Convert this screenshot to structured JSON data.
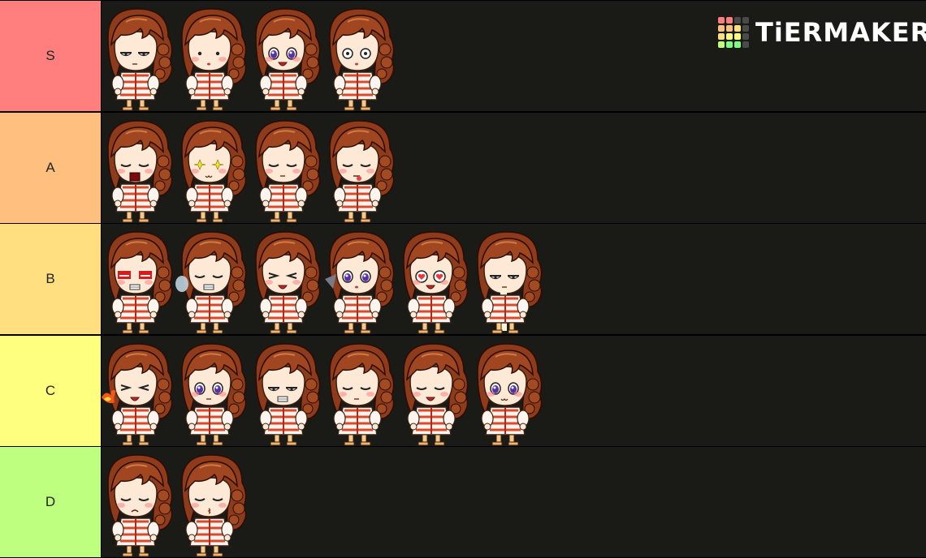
{
  "brand": {
    "name": "TiERMAKER",
    "logo_colors": [
      "#ff7f7f",
      "#ffbf7f",
      "#ffdf7f",
      "#ffff7f",
      "#bfff7f",
      "#7fff7f",
      "#4a4a4a"
    ]
  },
  "tiers": [
    {
      "label": "S",
      "color": "#ff7f7f",
      "items": [
        {
          "name": "annoyed",
          "eyes": "half",
          "mouth": "flat",
          "extra": ""
        },
        {
          "name": "blush",
          "eyes": "dot",
          "mouth": "small",
          "extra": "blush"
        },
        {
          "name": "sparkle-purple",
          "eyes": "purple",
          "mouth": "open",
          "extra": "blush"
        },
        {
          "name": "surprised",
          "eyes": "wide",
          "mouth": "small",
          "extra": ""
        }
      ]
    },
    {
      "label": "A",
      "color": "#ffbf7f",
      "items": [
        {
          "name": "crying-yell",
          "eyes": "closed",
          "mouth": "yell",
          "extra": "blush"
        },
        {
          "name": "star-eyes",
          "eyes": "star",
          "mouth": "cat",
          "extra": "blush"
        },
        {
          "name": "sleepy",
          "eyes": "closed",
          "mouth": "flat",
          "extra": "blush"
        },
        {
          "name": "tongue",
          "eyes": "closed",
          "mouth": "tongue",
          "extra": "blush"
        }
      ]
    },
    {
      "label": "B",
      "color": "#ffdf7f",
      "items": [
        {
          "name": "angry-red",
          "eyes": "red",
          "mouth": "grit",
          "extra": "blush"
        },
        {
          "name": "sigh",
          "eyes": "closed",
          "mouth": "grit",
          "extra": "puff-blue"
        },
        {
          "name": "laugh",
          "eyes": "squint",
          "mouth": "open",
          "extra": "blush"
        },
        {
          "name": "dizzy",
          "eyes": "purple",
          "mouth": "small",
          "extra": "puff-grey"
        },
        {
          "name": "heart-eyes",
          "eyes": "heart",
          "mouth": "open",
          "extra": "blush"
        },
        {
          "name": "drool",
          "eyes": "half",
          "mouth": "flat",
          "extra": "drool"
        }
      ]
    },
    {
      "label": "C",
      "color": "#ffff7f",
      "items": [
        {
          "name": "fire",
          "eyes": "squint",
          "mouth": "open",
          "extra": "fire"
        },
        {
          "name": "wink-purple",
          "eyes": "purple",
          "mouth": "flat",
          "extra": "blush"
        },
        {
          "name": "smug",
          "eyes": "half",
          "mouth": "grit",
          "extra": ""
        },
        {
          "name": "content",
          "eyes": "closed",
          "mouth": "flat",
          "extra": "blush"
        },
        {
          "name": "grin",
          "eyes": "closed",
          "mouth": "open",
          "extra": "blush"
        },
        {
          "name": "wink",
          "eyes": "purple",
          "mouth": "cat",
          "extra": "blush"
        }
      ]
    },
    {
      "label": "D",
      "color": "#bfff7f",
      "items": [
        {
          "name": "sad",
          "eyes": "closed",
          "mouth": "frown",
          "extra": "blush"
        },
        {
          "name": "kiss",
          "eyes": "closed",
          "mouth": "kiss",
          "extra": "blush"
        }
      ]
    }
  ]
}
